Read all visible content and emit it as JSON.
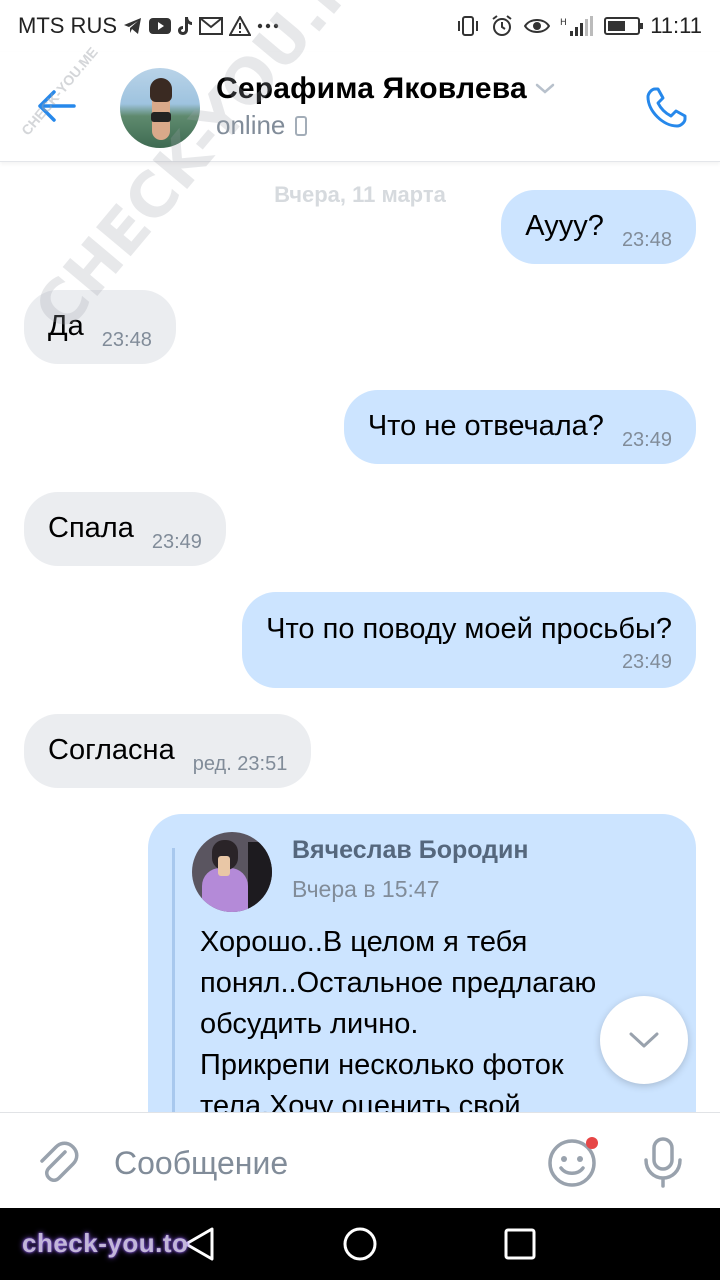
{
  "status_bar": {
    "carrier": "MTS RUS",
    "notification_icons": [
      "telegram-icon",
      "youtube-icon",
      "tiktok-icon",
      "mail-icon",
      "warning-icon",
      "more-icon"
    ],
    "system_icons": [
      "vibrate-icon",
      "alarm-icon",
      "eye-icon",
      "signal-icon",
      "battery-icon"
    ],
    "battery_level": 0.6,
    "time": "11:11"
  },
  "header": {
    "contact_name": "Серафима Яковлева",
    "contact_status": "online",
    "back_icon": "arrow-left-icon",
    "call_icon": "phone-icon",
    "accent_color": "#2688eb"
  },
  "watermarks": {
    "small": "CHECK-YOU.ME",
    "big": "CHECK-YOU.ME",
    "brand": "check-you.to"
  },
  "chat": {
    "date_separator": "Вчера, 11 марта",
    "messages": [
      {
        "direction": "out",
        "text": "Аууу?",
        "time": "23:48"
      },
      {
        "direction": "in",
        "text": "Да",
        "time": "23:48"
      },
      {
        "direction": "out",
        "text": "Что не отвечала?",
        "time": "23:49"
      },
      {
        "direction": "in",
        "text": "Спала",
        "time": "23:49"
      },
      {
        "direction": "out",
        "text": "Что по поводу моей просьбы?",
        "time": "23:49"
      },
      {
        "direction": "in",
        "text": "Согласна",
        "time": "ред. 23:51"
      }
    ],
    "forwarded": {
      "author": "Вячеслав Бородин",
      "date": "Вчера в 15:47",
      "text_lines": [
        "Хорошо..В целом я тебя",
        "понял..Остальное предлагаю",
        "обсудить лично.",
        "Прикрепи несколько фоток",
        "тела.Хочу оценить свой"
      ]
    },
    "outgoing_bubble_color": "#cce4ff",
    "incoming_bubble_color": "#ebedf0"
  },
  "composer": {
    "placeholder": "Сообщение",
    "value": ""
  }
}
